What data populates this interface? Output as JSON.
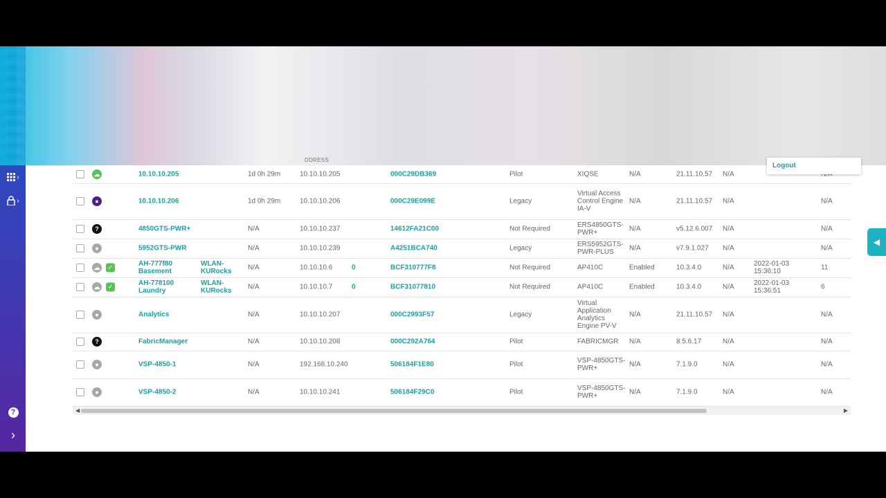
{
  "header": {
    "col_hint": "DDRESS",
    "logout_label": "Logout"
  },
  "sidebar": {
    "grid_icon": "grid-icon",
    "lock_icon": "lock-icon",
    "help_icon": "help-icon",
    "expand_icon": "chevron-right-icon"
  },
  "colors": {
    "accent": "#1aa0a5",
    "sidebar_top": "#1f57c8",
    "sidebar_bottom": "#5626a0",
    "status_green": "#57c25a",
    "status_purple": "#4d1f8c"
  },
  "rows": [
    {
      "status": "green",
      "status_icon": "cloud-icon",
      "name": "10.10.10.205",
      "name2": "",
      "ssid": "",
      "uptime": "1d 0h 29m",
      "ip": "10.10.10.205",
      "clients": "",
      "mac": "000C29DB369",
      "license": "Pilot",
      "model": "XIQSE",
      "wifi": "N/A",
      "version": "21.11.10.57",
      "policy": "N/A",
      "upd": "",
      "last": "N/A"
    },
    {
      "status": "purple",
      "status_icon": "location-icon",
      "name": "10.10.10.206",
      "name2": "",
      "ssid": "",
      "uptime": "1d 0h 29m",
      "ip": "10.10.10.206",
      "clients": "",
      "mac": "000C29E099E",
      "license": "Legacy",
      "model": "Virtual Access Control Engine IA-V",
      "wifi": "N/A",
      "version": "21.11.10.57",
      "policy": "N/A",
      "upd": "",
      "last": "N/A"
    },
    {
      "status": "black",
      "status_icon": "question-icon",
      "name": "4850GTS-PWR+",
      "name2": "",
      "ssid": "",
      "uptime": "N/A",
      "ip": "10.10.10.237",
      "clients": "",
      "mac": "14612FA21C00",
      "license": "Not Required",
      "model": "ERS4850GTS-PWR+",
      "wifi": "N/A",
      "version": "v5.12.6.007",
      "policy": "N/A",
      "upd": "",
      "last": "N/A"
    },
    {
      "status": "gray",
      "status_icon": "location-icon",
      "name": "5952GTS-PWR",
      "name2": "",
      "ssid": "",
      "uptime": "N/A",
      "ip": "10.10.10.239",
      "clients": "",
      "mac": "A4251BCA740",
      "license": "Legacy",
      "model": "ERS5952GTS-PWR-PLUS",
      "wifi": "N/A",
      "version": "v7.9.1.027",
      "policy": "N/A",
      "upd": "",
      "last": "N/A"
    },
    {
      "status": "gray",
      "status_icon": "cloud-icon",
      "extra": true,
      "name": "AH-777f80",
      "name2": "Basement",
      "ssid": "WLAN-KURocks",
      "uptime": "N/A",
      "ip": "10.10.10.6",
      "clients": "0",
      "mac": "BCF310777F8",
      "license": "Not Required",
      "model": "AP410C",
      "wifi": "Enabled",
      "version": "10.3.4.0",
      "policy": "N/A",
      "upd": "2022-01-03 15:36:10",
      "last": "11"
    },
    {
      "status": "gray",
      "status_icon": "cloud-icon",
      "extra": true,
      "name": "AH-778100",
      "name2": "Laundry",
      "ssid": "WLAN-KURocks",
      "uptime": "N/A",
      "ip": "10.10.10.7",
      "clients": "0",
      "mac": "BCF31077810",
      "license": "Not Required",
      "model": "AP410C",
      "wifi": "Enabled",
      "version": "10.3.4.0",
      "policy": "N/A",
      "upd": "2022-01-03 15:36:51",
      "last": "6"
    },
    {
      "status": "gray",
      "status_icon": "location-icon",
      "name": "Analytics",
      "name2": "",
      "ssid": "",
      "uptime": "N/A",
      "ip": "10.10.10.207",
      "clients": "",
      "mac": "000C2993F57",
      "license": "Legacy",
      "model": "Virtual Application Analytics Engine PV-V",
      "wifi": "N/A",
      "version": "21.11.10.57",
      "policy": "N/A",
      "upd": "",
      "last": "N/A"
    },
    {
      "status": "black",
      "status_icon": "question-icon",
      "name": "FabricManager",
      "name2": "",
      "ssid": "",
      "uptime": "N/A",
      "ip": "10.10.10.208",
      "clients": "",
      "mac": "000C292A764",
      "license": "Pilot",
      "model": "FABRICMGR",
      "wifi": "N/A",
      "version": "8.5.6.17",
      "policy": "N/A",
      "upd": "",
      "last": "N/A"
    },
    {
      "status": "gray",
      "status_icon": "location-icon",
      "name": "VSP-4850-1",
      "name2": "",
      "ssid": "",
      "uptime": "N/A",
      "ip": "192.168.10.240",
      "clients": "",
      "mac": "506184F1E80",
      "license": "Pilot",
      "model": "VSP-4850GTS-PWR+",
      "wifi": "N/A",
      "version": "7.1.9.0",
      "policy": "N/A",
      "upd": "",
      "last": "N/A"
    },
    {
      "status": "gray",
      "status_icon": "location-icon",
      "name": "VSP-4850-2",
      "name2": "",
      "ssid": "",
      "uptime": "N/A",
      "ip": "10.10.10.241",
      "clients": "",
      "mac": "506184F29C0",
      "license": "Pilot",
      "model": "VSP-4850GTS-PWR+",
      "wifi": "N/A",
      "version": "7.1.9.0",
      "policy": "N/A",
      "upd": "",
      "last": "N/A"
    }
  ]
}
